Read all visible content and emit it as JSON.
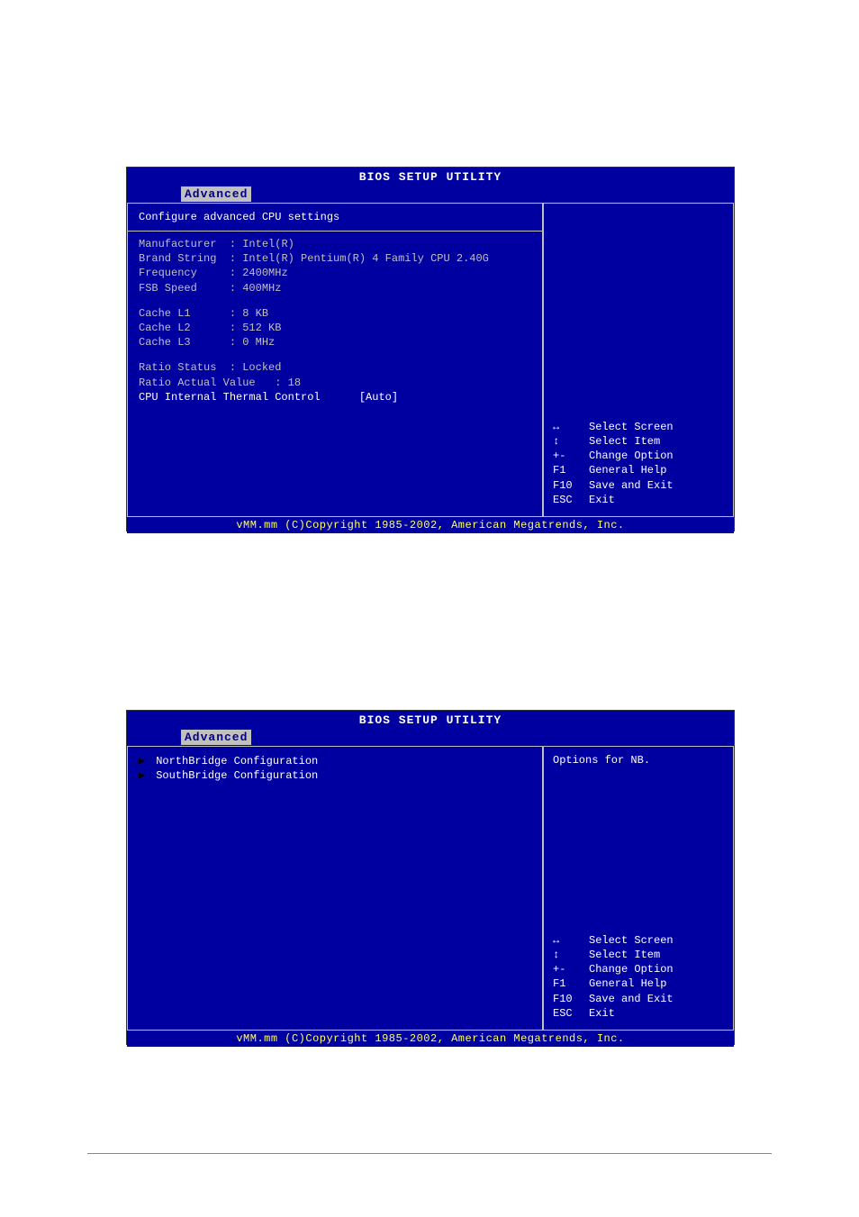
{
  "bios1": {
    "title": "BIOS SETUP UTILITY",
    "tab": "Advanced",
    "section_header": "Configure advanced CPU settings",
    "info": {
      "manufacturer_label": "Manufacturer",
      "manufacturer_value": "Intel(R)",
      "brand_label": "Brand String",
      "brand_value": "Intel(R) Pentium(R) 4 Family CPU 2.40G",
      "freq_label": "Frequency",
      "freq_value": "2400MHz",
      "fsb_label": "FSB Speed",
      "fsb_value": "400MHz",
      "l1_label": "Cache L1",
      "l1_value": "8 KB",
      "l2_label": "Cache L2",
      "l2_value": "512 KB",
      "l3_label": "Cache L3",
      "l3_value": "0 MHz",
      "ratio_status_label": "Ratio Status",
      "ratio_status_value": "Locked",
      "ratio_actual_label": "Ratio Actual Value",
      "ratio_actual_value": "18",
      "thermal_label": "CPU Internal Thermal Control",
      "thermal_value": "[Auto]"
    },
    "help": [
      {
        "key": "↔",
        "text": "Select Screen"
      },
      {
        "key": "↕",
        "text": "Select Item"
      },
      {
        "key": "+-",
        "text": "Change Option"
      },
      {
        "key": "F1",
        "text": "General Help"
      },
      {
        "key": "F10",
        "text": "Save and Exit"
      },
      {
        "key": "ESC",
        "text": "Exit"
      }
    ],
    "footer": "vMM.mm (C)Copyright 1985-2002, American Megatrends, Inc."
  },
  "bios2": {
    "title": "BIOS SETUP UTILITY",
    "tab": "Advanced",
    "submenus": [
      "NorthBridge Configuration",
      "SouthBridge Configuration"
    ],
    "right_info": "Options for NB.",
    "help": [
      {
        "key": "↔",
        "text": "Select Screen"
      },
      {
        "key": "↕",
        "text": "Select Item"
      },
      {
        "key": "+-",
        "text": "Change Option"
      },
      {
        "key": "F1",
        "text": "General Help"
      },
      {
        "key": "F10",
        "text": "Save and Exit"
      },
      {
        "key": "ESC",
        "text": "Exit"
      }
    ],
    "footer": "vMM.mm (C)Copyright 1985-2002, American Megatrends, Inc."
  }
}
